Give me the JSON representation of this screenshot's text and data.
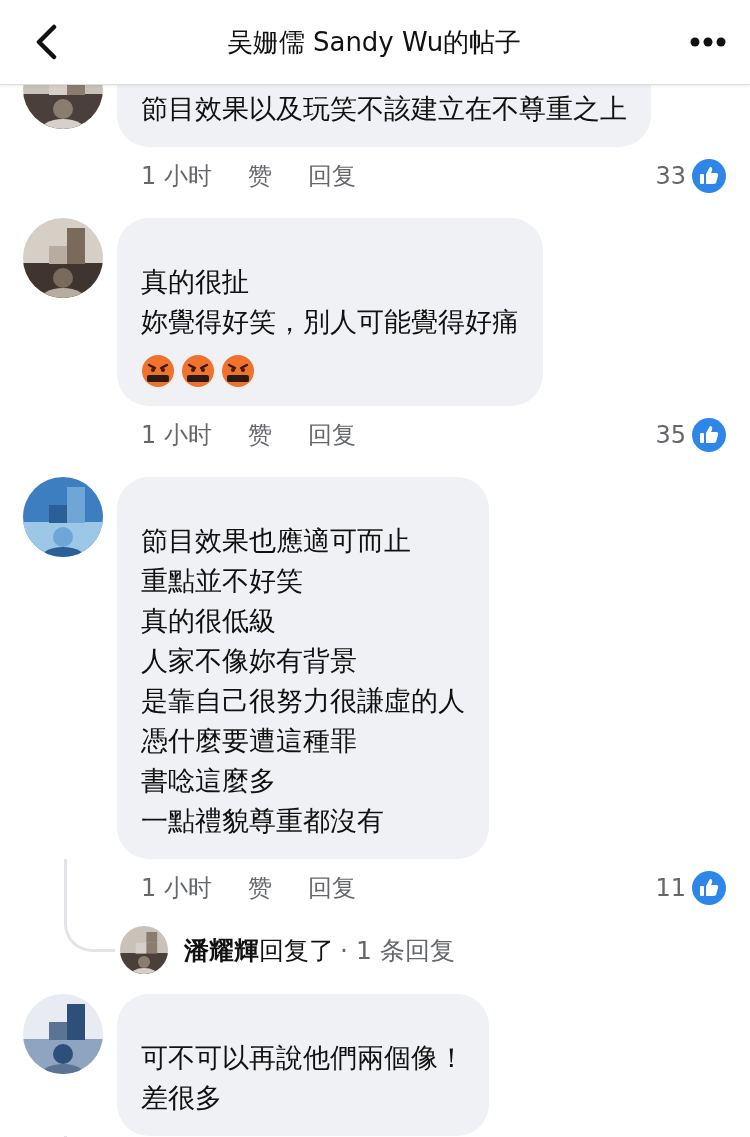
{
  "header": {
    "title": "吴姗儒 Sandy Wu的帖子"
  },
  "comments": [
    {
      "avatar": {
        "kind": "picture"
      },
      "clipped_top": true,
      "lines": [
        "節目效果以及玩笑不該建立在不尊重之上"
      ],
      "time": "1 小时",
      "like": "赞",
      "reply": "回复",
      "reactions": "33"
    },
    {
      "avatar": {
        "kind": "picture"
      },
      "clipped_top": false,
      "lines": [
        "真的很扯",
        "妳覺得好笑，別人可能覺得好痛"
      ],
      "emojis": [
        {
          "kind": "angry"
        },
        {
          "kind": "angry"
        },
        {
          "kind": "angry"
        }
      ],
      "time": "1 小时",
      "like": "赞",
      "reply": "回复",
      "reactions": "35"
    },
    {
      "avatar": {
        "kind": "picture"
      },
      "clipped_top": false,
      "lines": [
        "節目效果也應適可而止",
        "重點並不好笑",
        "真的很低級",
        "人家不像妳有背景",
        "是靠自己很努力很謙虛的人",
        "憑什麼要遭這種罪",
        "書唸這麼多",
        "一點禮貌尊重都沒有"
      ],
      "time": "1 小时",
      "like": "赞",
      "reply": "回复",
      "reactions": "11",
      "replies": {
        "avatar": {
          "kind": "picture"
        },
        "who": "**潘耀輝**回复了",
        "count": "· 1 条回复"
      }
    },
    {
      "avatar": {
        "kind": "picture"
      },
      "clipped_top": false,
      "lines": [
        "可不可以再說他們兩個像！",
        "差很多"
      ]
    }
  ]
}
